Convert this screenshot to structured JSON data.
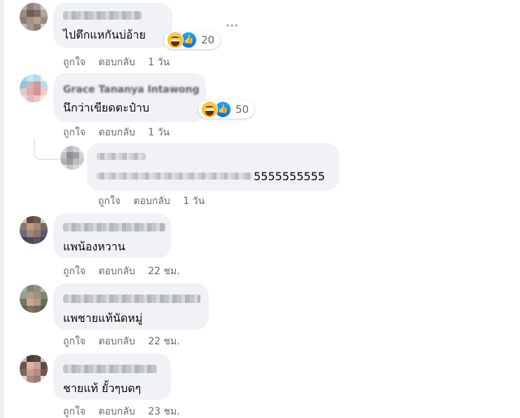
{
  "comments": [
    {
      "text": "ไปตึกแหกันบ่อ้าย",
      "actions": {
        "like": "ถูกใจ",
        "reply": "ตอบกลับ",
        "time": "1 วัน"
      },
      "reactions": {
        "count": "20",
        "icons": [
          "haha-icon",
          "like-icon"
        ]
      },
      "more": "⋯"
    },
    {
      "name": "Grace Tananya Intawong",
      "text": "นึกว่าเขียดตะป๋าบ",
      "actions": {
        "like": "ถูกใจ",
        "reply": "ตอบกลับ",
        "time": "1 วัน"
      },
      "reactions": {
        "count": "50",
        "icons": [
          "haha-icon",
          "like-icon"
        ]
      }
    },
    {
      "text_suffix": "5555555555",
      "actions": {
        "like": "ถูกใจ",
        "reply": "ตอบกลับ",
        "time": "1 วัน"
      }
    },
    {
      "text": "แพน้องหวาน",
      "actions": {
        "like": "ถูกใจ",
        "reply": "ตอบกลับ",
        "time": "22 ชม."
      }
    },
    {
      "text": "แพชายแท้นัดหมู่",
      "actions": {
        "like": "ถูกใจ",
        "reply": "ตอบกลับ",
        "time": "22 ชม."
      }
    },
    {
      "text": "ชายแท้ ยั้วๆบดๆ",
      "actions": {
        "like": "ถูกใจ",
        "reply": "ตอบกลับ",
        "time": "23 ชม."
      }
    }
  ],
  "colors": {
    "bubble": "#f0f2f5",
    "meta": "#65676b",
    "like_blue": "#0866ff",
    "haha_yellow": "#f9b51f"
  }
}
